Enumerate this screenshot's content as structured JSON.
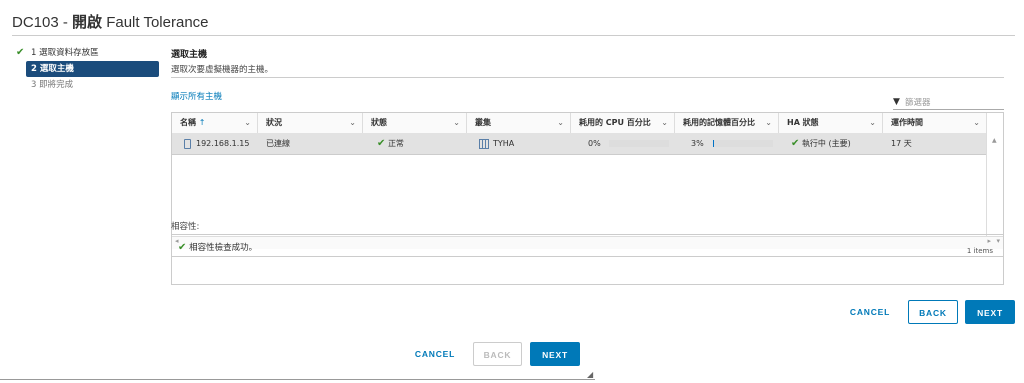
{
  "title": {
    "prefix": "DC103 - ",
    "bold": "開啟",
    "suffix": " Fault Tolerance"
  },
  "steps": [
    {
      "label": "1 選取資料存放區",
      "state": "done"
    },
    {
      "label": "2 選取主機",
      "state": "active"
    },
    {
      "label": "3 即將完成",
      "state": "pending"
    }
  ],
  "section": {
    "title": "選取主機",
    "description": "選取次要虛擬機器的主機。"
  },
  "show_all_link": "顯示所有主機",
  "filter": {
    "placeholder": "篩選器"
  },
  "grid": {
    "columns": [
      "名稱",
      "狀況",
      "狀態",
      "叢集",
      "耗用的 CPU 百分比",
      "耗用的記憶體百分比",
      "HA 狀態",
      "運作時間"
    ],
    "row": {
      "name": "192.168.1.15",
      "condition": "已連線",
      "status": "正常",
      "cluster": "TYHA",
      "cpu": "0%",
      "cpu_value": 0,
      "memory": "3%",
      "memory_value": 3,
      "ha_status": "執行中 (主要)",
      "uptime": "17 天"
    },
    "footer": "1 items"
  },
  "compatibility": {
    "label": "相容性:",
    "message": "相容性檢查成功。"
  },
  "inner_buttons": {
    "cancel": "CANCEL",
    "back": "BACK",
    "next": "NEXT"
  },
  "outer_buttons": {
    "cancel": "CANCEL",
    "back": "BACK",
    "next": "NEXT"
  },
  "colors": {
    "accent": "#0079b8",
    "active_step": "#1b4c7c",
    "success": "#3a8f2a"
  }
}
